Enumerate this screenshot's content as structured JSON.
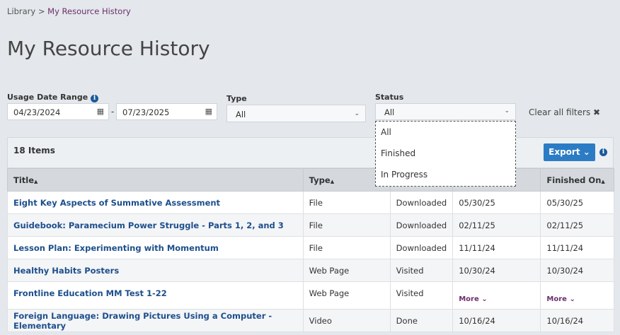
{
  "breadcrumb": {
    "parent": "Library",
    "separator": ">",
    "current": "My Resource History"
  },
  "page_title": "My Resource History",
  "filters": {
    "date_range": {
      "label": "Usage Date Range",
      "from": "04/23/2024",
      "separator": "-",
      "to": "07/23/2025"
    },
    "type": {
      "label": "Type",
      "value": "All"
    },
    "status": {
      "label": "Status",
      "value": "All",
      "options": [
        "All",
        "Finished",
        "In Progress"
      ]
    },
    "clear_label": "Clear all filters"
  },
  "table": {
    "count": "18 Items",
    "export_label": "Export",
    "columns": [
      "Title",
      "Type",
      "",
      "",
      "Finished On"
    ],
    "rows": [
      {
        "title": "Eight Key Aspects of Summative Assessment",
        "type": "File",
        "status": "Downloaded",
        "date": "05/30/25",
        "finished": "05/30/25"
      },
      {
        "title": "Guidebook: Paramecium Power Struggle - Parts 1, 2, and 3",
        "type": "File",
        "status": "Downloaded",
        "date": "02/11/25",
        "finished": "02/11/25"
      },
      {
        "title": "Lesson Plan: Experimenting with Momentum",
        "type": "File",
        "status": "Downloaded",
        "date": "11/11/24",
        "finished": "11/11/24"
      },
      {
        "title": "Healthy Habits Posters",
        "type": "Web Page",
        "status": "Visited",
        "date": "10/30/24",
        "finished": "10/30/24"
      },
      {
        "title": "Frontline Education MM Test 1-22",
        "type": "Web Page",
        "status": "Visited",
        "date": "More",
        "finished": "More"
      },
      {
        "title": "Foreign Language: Drawing Pictures Using a Computer - Elementary",
        "type": "Video",
        "status": "Done",
        "date": "10/16/24",
        "finished": "10/16/24"
      }
    ]
  }
}
